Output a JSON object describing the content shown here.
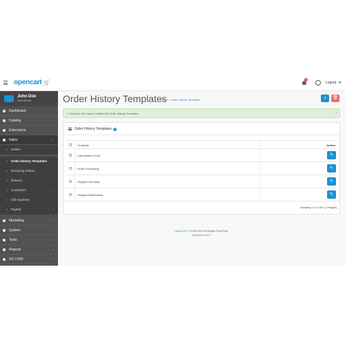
{
  "header": {
    "logo_text": "opencart",
    "logo_cart": "🛒",
    "notification_count": "4",
    "logout_label": "Logout"
  },
  "profile": {
    "name": "John Doe",
    "role": "Administrator"
  },
  "sidebar": {
    "items": [
      {
        "label": "Dashboard",
        "chevron": ""
      },
      {
        "label": "Catalog",
        "chevron": "›"
      },
      {
        "label": "Extensions",
        "chevron": "›"
      },
      {
        "label": "Sales",
        "chevron": "⌄"
      },
      {
        "label": "Marketing",
        "chevron": "›"
      },
      {
        "label": "System",
        "chevron": "›"
      },
      {
        "label": "Tools",
        "chevron": "›"
      },
      {
        "label": "Reports",
        "chevron": "›"
      },
      {
        "label": "OC-CRM",
        "chevron": "›"
      }
    ],
    "sales_sub": [
      {
        "label": "Orders",
        "chevron": ""
      },
      {
        "label": "Order History Templates",
        "chevron": ""
      },
      {
        "label": "Recurring Orders",
        "chevron": ""
      },
      {
        "label": "Returns",
        "chevron": ""
      },
      {
        "label": "Customers",
        "chevron": "›"
      },
      {
        "label": "Gift Vouchers",
        "chevron": "›"
      },
      {
        "label": "PayPal",
        "chevron": "›"
      }
    ]
  },
  "page": {
    "title": "Order History Templates",
    "breadcrumb_home": "Home",
    "breadcrumb_sep": "›",
    "breadcrumb_current": "Order History Templates",
    "add_icon": "+",
    "delete_icon": "🗑"
  },
  "alert": {
    "text": "✓ Success: You have modified the Order History Template!",
    "close": "×"
  },
  "panel": {
    "title": "Order History Templates",
    "help": "?",
    "columns": {
      "template": "Template",
      "action": "Action"
    },
    "rows": [
      {
        "name": "Cancellation Order"
      },
      {
        "name": "Order Processing"
      },
      {
        "name": "Shipped Germany"
      },
      {
        "name": "Shipped Netherlands"
      }
    ],
    "edit_icon": "✎",
    "showing": "Showing 1 to 4 of 4 (1 Pages)"
  },
  "footer": {
    "brand": "OpenCart",
    "copyright": " © 2009-2015 All Rights Reserved.",
    "version": "Version 2.0.3.1"
  },
  "colors": {
    "accent": "#1e91cf",
    "danger": "#f56b6b",
    "sidebar": "#515151",
    "success_bg": "#dff0d8"
  }
}
